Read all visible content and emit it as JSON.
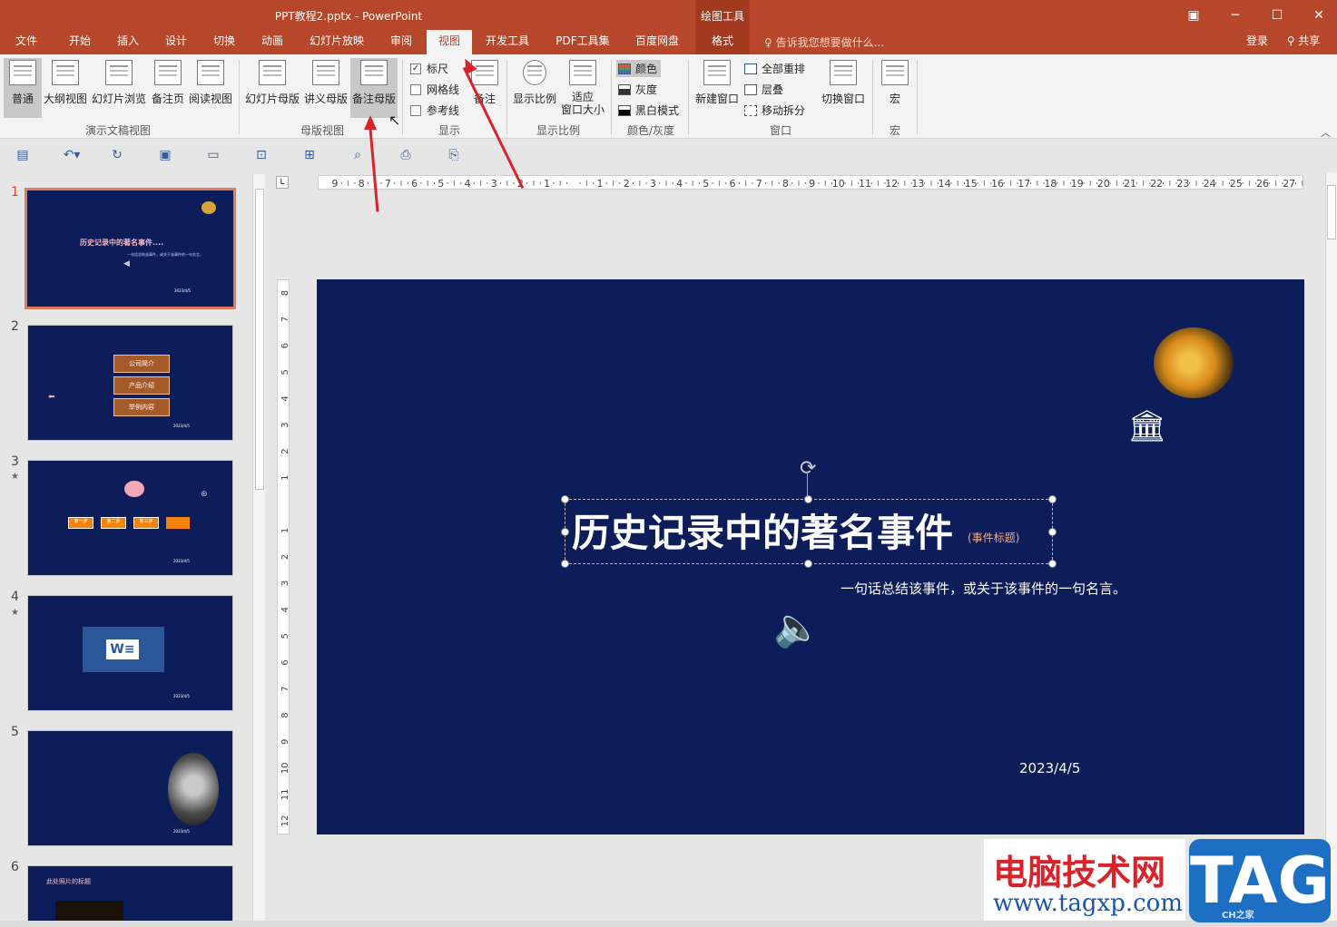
{
  "window": {
    "title": "PPT教程2.pptx - PowerPoint",
    "context_group": "绘图工具",
    "controls": [
      "restore-ribbon",
      "minimize",
      "maximize",
      "close"
    ]
  },
  "tabs": [
    {
      "label": "文件"
    },
    {
      "label": "开始"
    },
    {
      "label": "插入"
    },
    {
      "label": "设计"
    },
    {
      "label": "切换"
    },
    {
      "label": "动画"
    },
    {
      "label": "幻灯片放映"
    },
    {
      "label": "审阅"
    },
    {
      "label": "视图",
      "active": true
    },
    {
      "label": "开发工具"
    },
    {
      "label": "PDF工具集"
    },
    {
      "label": "百度网盘"
    },
    {
      "label": "格式",
      "contextual": true
    }
  ],
  "tell_me": "告诉我您想要做什么...",
  "account": {
    "login": "登录",
    "share": "共享"
  },
  "ribbon": {
    "presentation_views": {
      "label": "演示文稿视图",
      "buttons": [
        "普通",
        "大纲视图",
        "幻灯片浏览",
        "备注页",
        "阅读视图"
      ]
    },
    "master_views": {
      "label": "母版视图",
      "buttons": [
        "幻灯片母版",
        "讲义母版",
        "备注母版"
      ]
    },
    "show": {
      "label": "显示",
      "checkboxes": [
        {
          "label": "标尺",
          "checked": true
        },
        {
          "label": "网格线",
          "checked": false
        },
        {
          "label": "参考线",
          "checked": false
        }
      ],
      "notes": "备注"
    },
    "zoom": {
      "label": "显示比例",
      "buttons": [
        "显示比例",
        "适应\n窗口大小"
      ]
    },
    "color": {
      "label": "颜色/灰度",
      "items": [
        "颜色",
        "灰度",
        "黑白模式"
      ]
    },
    "window": {
      "label": "窗口",
      "new_window": "新建窗口",
      "items": [
        "全部重排",
        "层叠",
        "移动拆分"
      ],
      "switch": "切换窗口"
    },
    "macros": {
      "label": "宏",
      "button": "宏"
    }
  },
  "thumbnails": [
    {
      "num": "1",
      "star": "",
      "title": "历史记录中的著名事件....",
      "sub": "一句话总结该事件，或关于该事件的一句名言。",
      "date": "2023/4/5"
    },
    {
      "num": "2",
      "star": "",
      "items": [
        "公司简介",
        "产品介绍",
        "举例内容"
      ],
      "date": "2023/4/5"
    },
    {
      "num": "3",
      "star": "★",
      "steps": [
        "第一步",
        "第二步",
        "第三步",
        ""
      ],
      "date": "2023/4/5"
    },
    {
      "num": "4",
      "star": "★",
      "date": "2023/4/5"
    },
    {
      "num": "5",
      "star": "",
      "date": "2023/4/5"
    },
    {
      "num": "6",
      "star": "",
      "title": "此处照片的标题"
    }
  ],
  "ruler": {
    "h_ticks": [
      "9",
      "8",
      "7",
      "6",
      "5",
      "4",
      "3",
      "2",
      "1",
      "",
      "1",
      "2",
      "3",
      "4",
      "5",
      "6",
      "7",
      "8",
      "9",
      "10",
      "11",
      "12",
      "13",
      "14",
      "15",
      "16",
      "17",
      "18",
      "19",
      "20",
      "21",
      "22",
      "23",
      "24",
      "25",
      "26",
      "27"
    ],
    "v_ticks": [
      "8",
      "7",
      "6",
      "5",
      "4",
      "3",
      "2",
      "1",
      "",
      "1",
      "2",
      "3",
      "4",
      "5",
      "6",
      "7",
      "8",
      "9",
      "10",
      "11",
      "12"
    ]
  },
  "slide": {
    "title": "历史记录中的著名事件",
    "title_note": "(事件标题)",
    "subtitle": "一句话总结该事件，或关于该事件的一句名言。",
    "date": "2023/4/5"
  },
  "watermark": {
    "cn": "电脑技术网",
    "url": "www.tagxp.com",
    "logo": "TAG",
    "logo_sub": "CH之家"
  },
  "colors": {
    "brand": "#b7472a",
    "slide_bg": "#0c1d5a",
    "selection": "#e07b5a"
  }
}
